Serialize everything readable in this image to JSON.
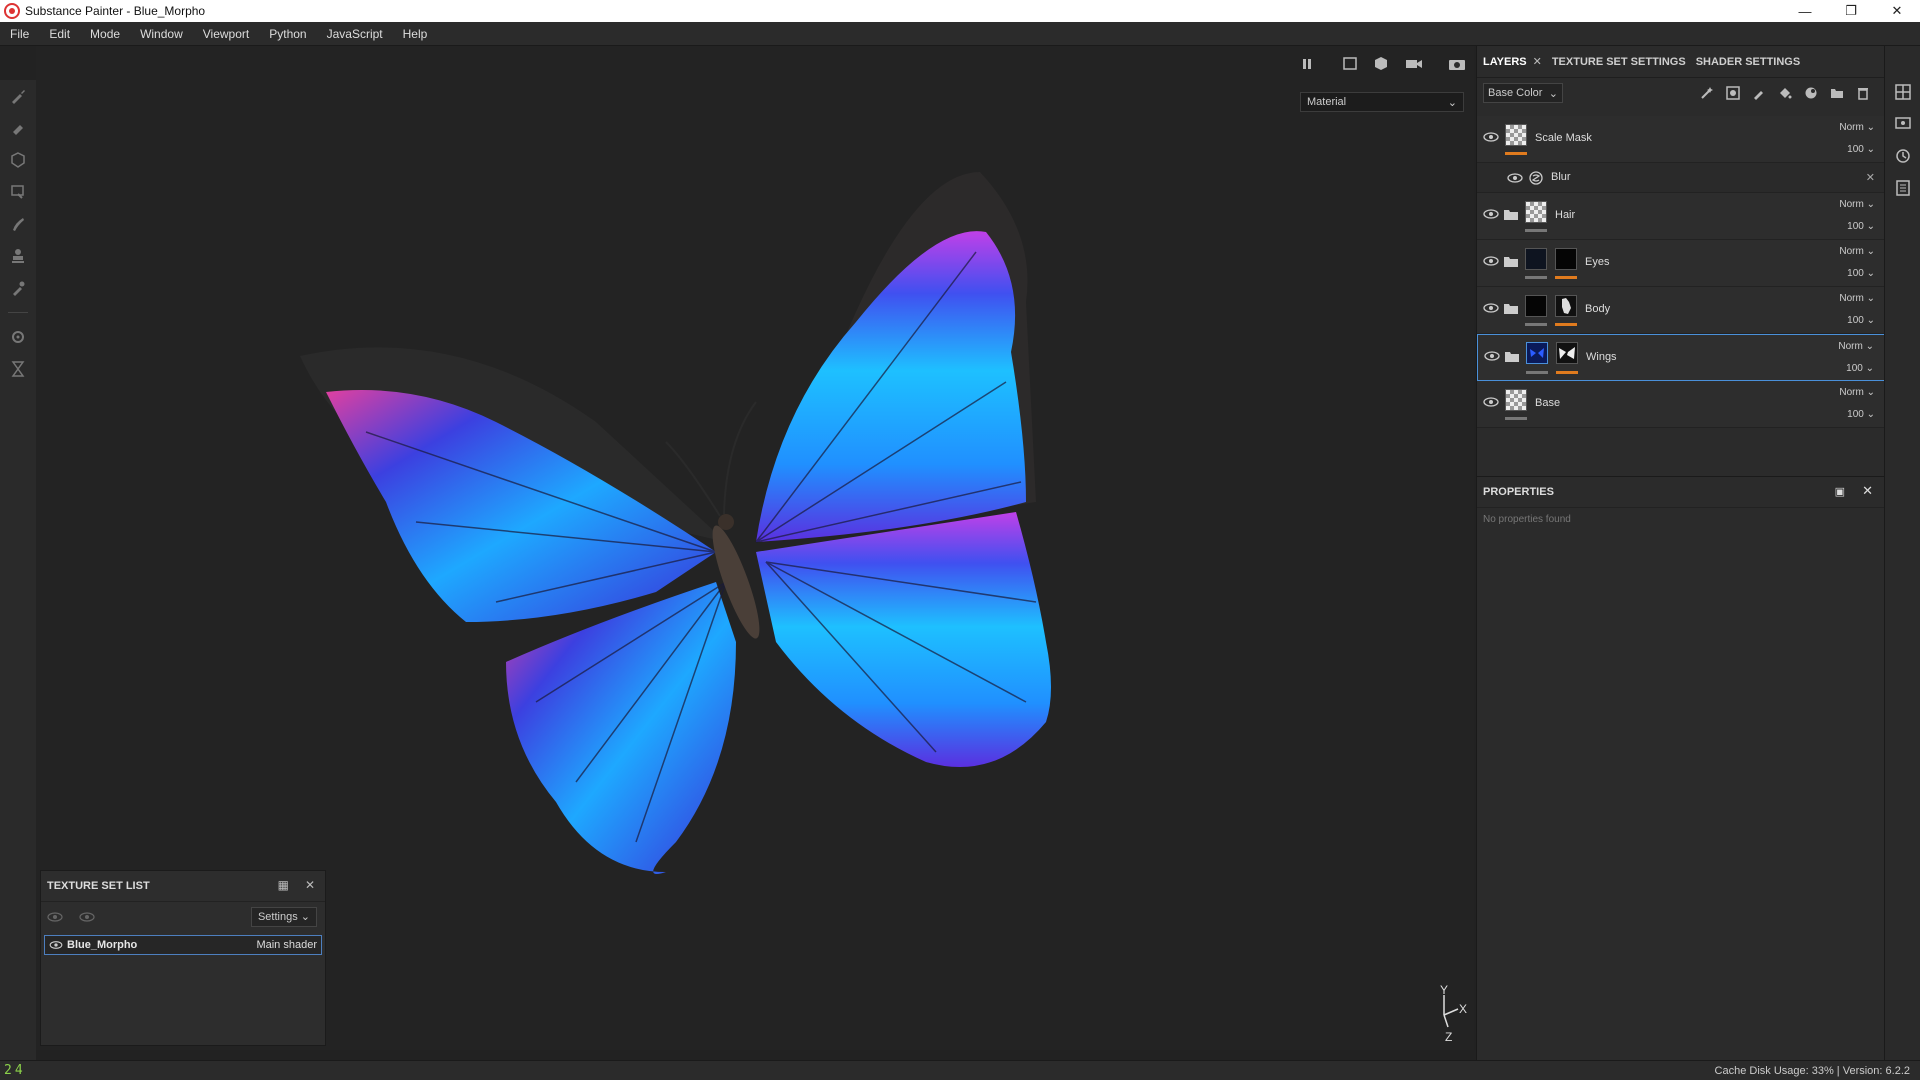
{
  "window": {
    "title": "Substance Painter - Blue_Morpho"
  },
  "menu": [
    "File",
    "Edit",
    "Mode",
    "Window",
    "Viewport",
    "Python",
    "JavaScript",
    "Help"
  ],
  "viewport": {
    "material_mode": "Material",
    "axis": {
      "y": "Y",
      "x": "X",
      "z": "Z"
    }
  },
  "texture_set_list": {
    "title": "TEXTURE SET LIST",
    "settings_label": "Settings",
    "rows": [
      {
        "name": "Blue_Morpho",
        "shader": "Main shader"
      }
    ]
  },
  "right_panel": {
    "tabs": [
      "LAYERS",
      "TEXTURE SET SETTINGS",
      "SHADER SETTINGS"
    ],
    "channel": "Base Color",
    "layers": [
      {
        "name": "Scale Mask",
        "blend": "Norm",
        "opacity": "100",
        "accent": "#e07b1e"
      },
      {
        "name": "Blur",
        "is_effect": true
      },
      {
        "name": "Hair",
        "blend": "Norm",
        "opacity": "100",
        "accent": "#777777"
      },
      {
        "name": "Eyes",
        "blend": "Norm",
        "opacity": "100",
        "accent": "#e07b1e"
      },
      {
        "name": "Body",
        "blend": "Norm",
        "opacity": "100",
        "accent": "#e07b1e"
      },
      {
        "name": "Wings",
        "blend": "Norm",
        "opacity": "100",
        "accent": "#e07b1e"
      },
      {
        "name": "Base",
        "blend": "Norm",
        "opacity": "100",
        "accent": "#777777"
      }
    ],
    "properties": {
      "title": "PROPERTIES",
      "empty_text": "No properties found"
    }
  },
  "status": {
    "fps": "24",
    "text": "Cache Disk Usage:   33% | Version: 6.2.2"
  },
  "colors": {
    "accent": "#e07b1e",
    "selection": "#4a90d9"
  }
}
